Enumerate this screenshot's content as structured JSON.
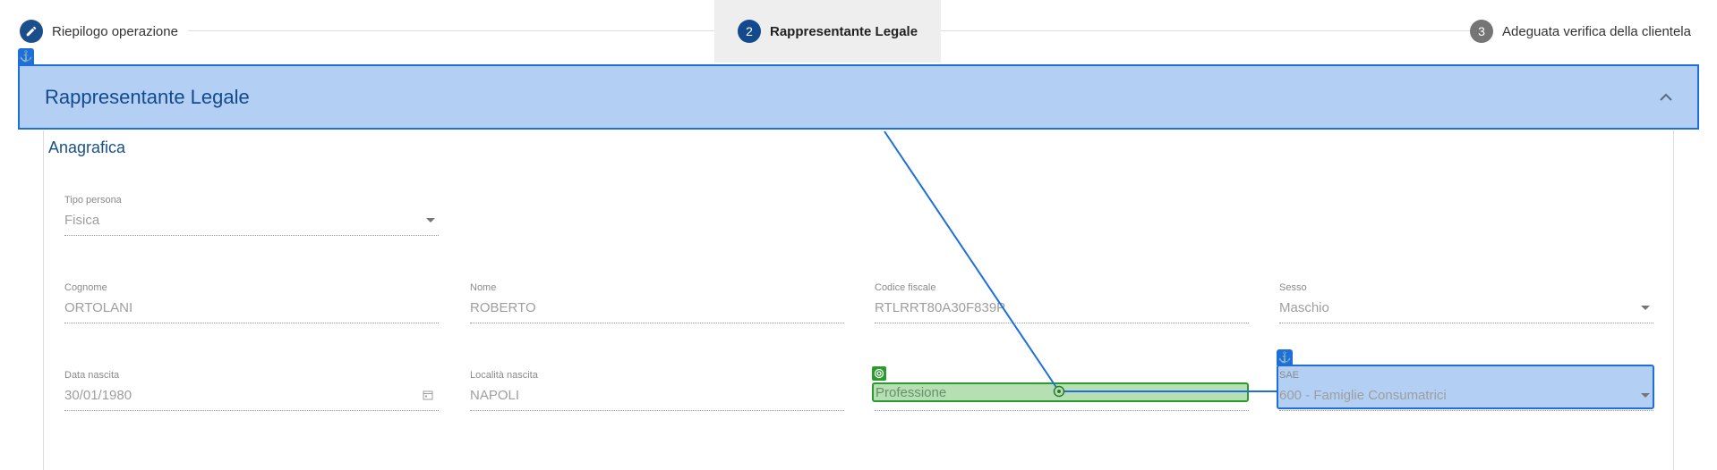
{
  "stepper": {
    "steps": [
      {
        "label": "Riepilogo operazione",
        "marker": "pencil-icon",
        "state": "done"
      },
      {
        "label": "Rappresentante Legale",
        "marker": "2",
        "state": "active"
      },
      {
        "label": "Adeguata verifica della clientela",
        "marker": "3",
        "state": "pending"
      }
    ]
  },
  "section": {
    "title": "Rappresentante Legale",
    "toggle_icon": "chevron-up-icon"
  },
  "anagrafica": {
    "title": "Anagrafica",
    "fields": {
      "tipo_persona": {
        "label": "Tipo persona",
        "value": "Fisica"
      },
      "cognome": {
        "label": "Cognome",
        "value": "ORTOLANI"
      },
      "nome": {
        "label": "Nome",
        "value": "ROBERTO"
      },
      "codice_fiscale": {
        "label": "Codice fiscale",
        "value": "RTLRRT80A30F839P"
      },
      "sesso": {
        "label": "Sesso",
        "value": "Maschio"
      },
      "data_nascita": {
        "label": "Data nascita",
        "value": "30/01/1980"
      },
      "localita_nascita": {
        "label": "Località nascita",
        "value": "NAPOLI"
      },
      "professione": {
        "label": "Professione",
        "value": ""
      },
      "sae": {
        "label": "SAE",
        "value": "600 - Famiglie Consumatrici"
      }
    }
  },
  "colors": {
    "primary": "#134a8e",
    "step_done": "#1b4f8c",
    "step_pending": "#757575",
    "highlight_blue": "#b3d0f4",
    "highlight_blue_border": "#1e6fd9",
    "highlight_green": "#b6dfb3",
    "highlight_green_border": "#2c9a2c"
  }
}
